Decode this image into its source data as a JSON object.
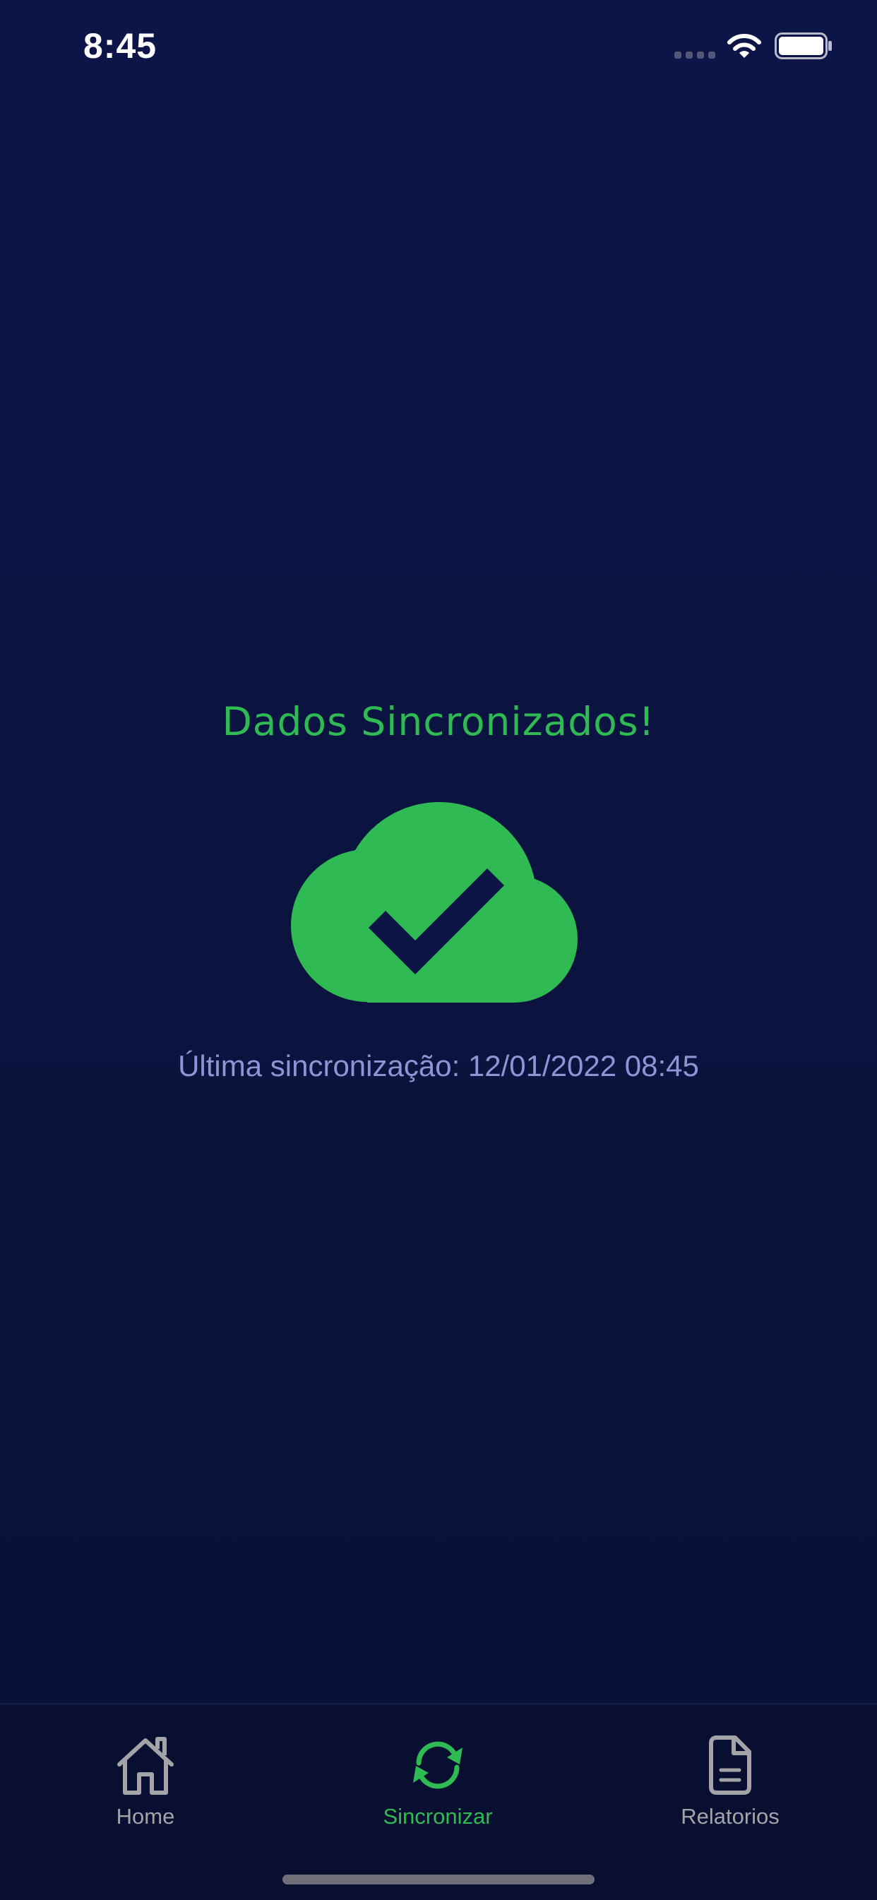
{
  "status_bar": {
    "time": "8:45",
    "icons": [
      "signal-icon",
      "wifi-icon",
      "battery-icon"
    ]
  },
  "main": {
    "title": "Dados Sincronizados!",
    "icon": "cloud-check-icon",
    "last_sync": "Última sincronização: 12/01/2022 08:45"
  },
  "tabs": [
    {
      "label": "Home",
      "icon": "home-icon",
      "active": false
    },
    {
      "label": "Sincronizar",
      "icon": "sync-icon",
      "active": true
    },
    {
      "label": "Relatorios",
      "icon": "document-icon",
      "active": false
    }
  ],
  "colors": {
    "background": "#0b1440",
    "accent": "#2fba53",
    "muted_text": "#8f94d6",
    "inactive_tab": "#a3a3a8"
  }
}
